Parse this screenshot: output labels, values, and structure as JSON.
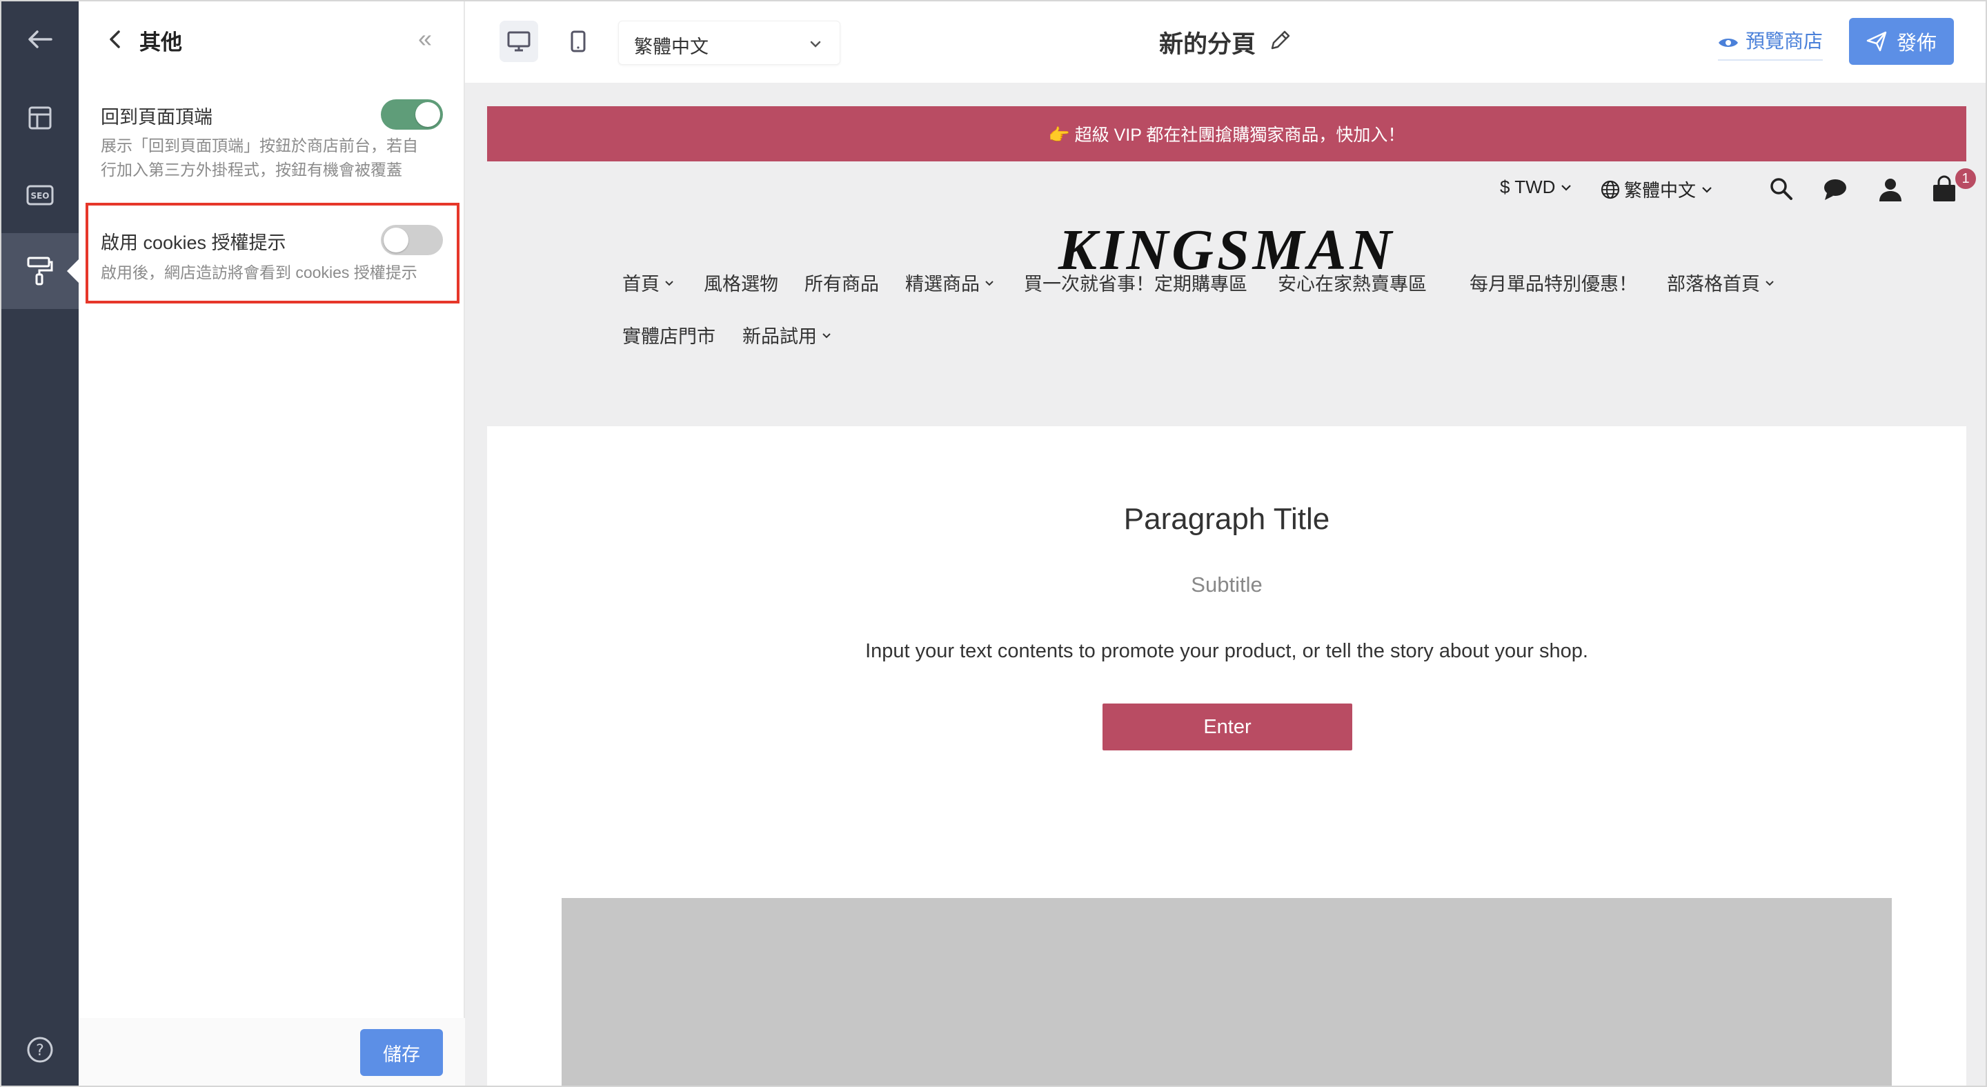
{
  "panel": {
    "title": "其他",
    "settings": [
      {
        "label": "回到頁面頂端",
        "description": "展示「回到頁面頂端」按鈕於商店前台，若自行加入第三方外掛程式，按鈕有機會被覆蓋",
        "enabled": true
      },
      {
        "label": "啟用 cookies 授權提示",
        "description": "啟用後，網店造訪將會看到 cookies 授權提示",
        "enabled": false
      }
    ],
    "save_label": "儲存",
    "collapse_glyph": "«"
  },
  "topbar": {
    "language": "繁體中文",
    "page_title": "新的分頁",
    "preview_label": "預覽商店",
    "publish_label": "發佈"
  },
  "store": {
    "announcement": "👉 超級 VIP 都在社團搶購獨家商品，快加入！",
    "currency": "$ TWD",
    "language": "繁體中文",
    "cart_count": "1",
    "logo": "KINGSMAN",
    "nav": [
      {
        "label": "首頁",
        "dropdown": true
      },
      {
        "label": "風格選物",
        "dropdown": false
      },
      {
        "label": "所有商品",
        "dropdown": false
      },
      {
        "label": "精選商品",
        "dropdown": true
      },
      {
        "label": "買一次就省事！定期購專區",
        "dropdown": false
      },
      {
        "label": "安心在家熱賣專區",
        "dropdown": false
      },
      {
        "label": "每月單品特別優惠！",
        "dropdown": false
      },
      {
        "label": "部落格首頁",
        "dropdown": true
      },
      {
        "label": "實體店門市",
        "dropdown": false
      },
      {
        "label": "新品試用",
        "dropdown": true
      }
    ],
    "content": {
      "title": "Paragraph Title",
      "subtitle": "Subtitle",
      "body": "Input your text contents to promote your product, or tell the story about your shop.",
      "button_label": "Enter"
    }
  },
  "colors": {
    "rail": "#333a4a",
    "accent": "#5c8fe6",
    "toggle_on": "#5f9d79",
    "brand": "#b94c63",
    "highlight": "#e6372a"
  },
  "icons": [
    "back-arrow-icon",
    "layout-icon",
    "seo-icon",
    "paint-roller-icon",
    "help-icon",
    "desktop-icon",
    "mobile-icon",
    "pencil-icon",
    "eye-icon",
    "send-icon",
    "globe-icon",
    "search-icon",
    "chat-icon",
    "user-icon",
    "cart-icon"
  ]
}
